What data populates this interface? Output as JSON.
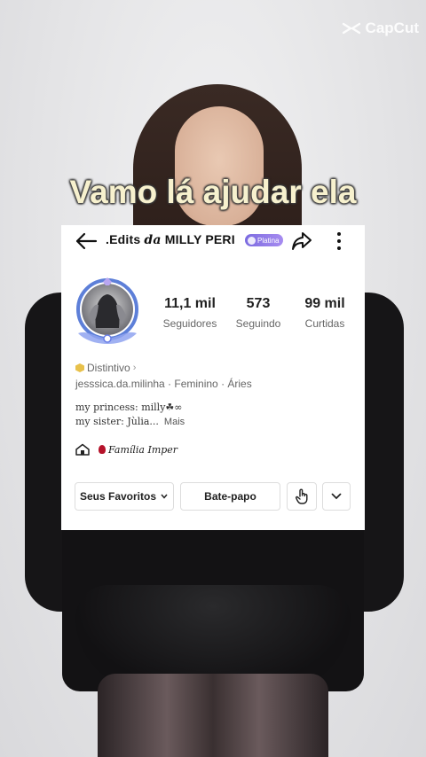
{
  "watermark": {
    "brand": "CapCut"
  },
  "caption": "Vamo lá ajudar ela",
  "profile": {
    "title_prefix": ".Edits ",
    "title_italic": "da",
    "title_suffix": " MILLY PERI",
    "tier_badge": "Platina",
    "stats": [
      {
        "value": "11,1 mil",
        "label": "Seguidores"
      },
      {
        "value": "573",
        "label": "Seguindo"
      },
      {
        "value": "99 mil",
        "label": "Curtidas"
      }
    ],
    "distintivo": "Distintivo",
    "handle_line": "jesssica.da.milinha · Feminino · Áries",
    "bio_line1": "my princess: milly☘∞",
    "bio_line2": "my sister: Jùlia...",
    "bio_more": "Mais",
    "family_label": "Família Imper"
  },
  "buttons": {
    "favorites": "Seus Favoritos",
    "chat": "Bate-papo"
  },
  "icons": {
    "back": "arrow-left-icon",
    "share": "share-icon",
    "more": "more-vertical-icon",
    "favorites_caret": "chevron-down-icon",
    "poke": "hand-pointer-icon",
    "expand": "chevron-down-icon",
    "family": "house-icon"
  },
  "colors": {
    "caption": "#f7f1ce",
    "badge": "#8a76e8"
  }
}
